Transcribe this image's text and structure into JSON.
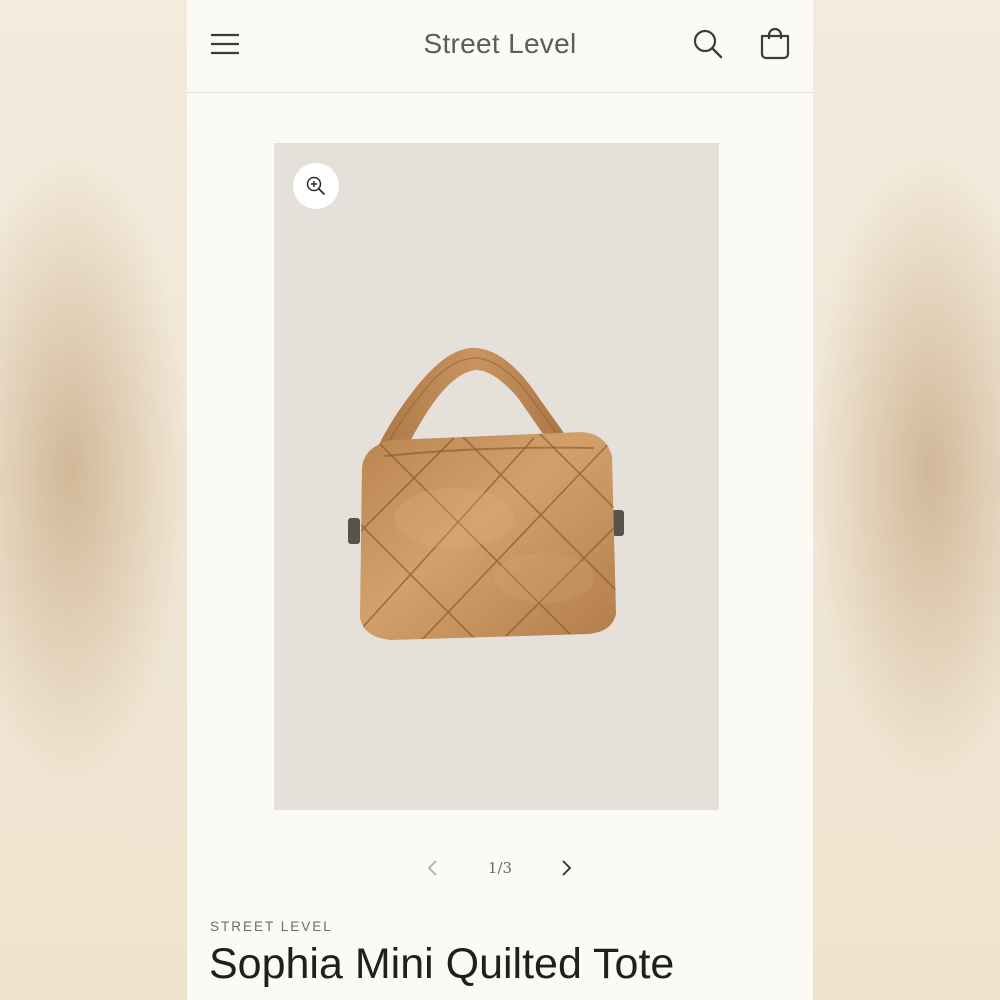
{
  "header": {
    "logo_text": "Street Level",
    "icons": [
      "hamburger-menu-icon",
      "search-icon",
      "cart-bag-icon"
    ]
  },
  "gallery": {
    "zoom_icon": "zoom-in-icon",
    "image_subject": "tan quilted mini tote bag",
    "pager_text": "1/3",
    "current_slide": 1,
    "total_slides": 3
  },
  "product": {
    "vendor": "STREET LEVEL",
    "title": "Sophia Mini Quilted Tote"
  },
  "colors": {
    "page_bg": "#fbfaf4",
    "gallery_bg": "#e6e0da",
    "bag_tan": "#c9955f",
    "text_dark": "#1f1f1f",
    "text_muted": "#6e6b66"
  }
}
